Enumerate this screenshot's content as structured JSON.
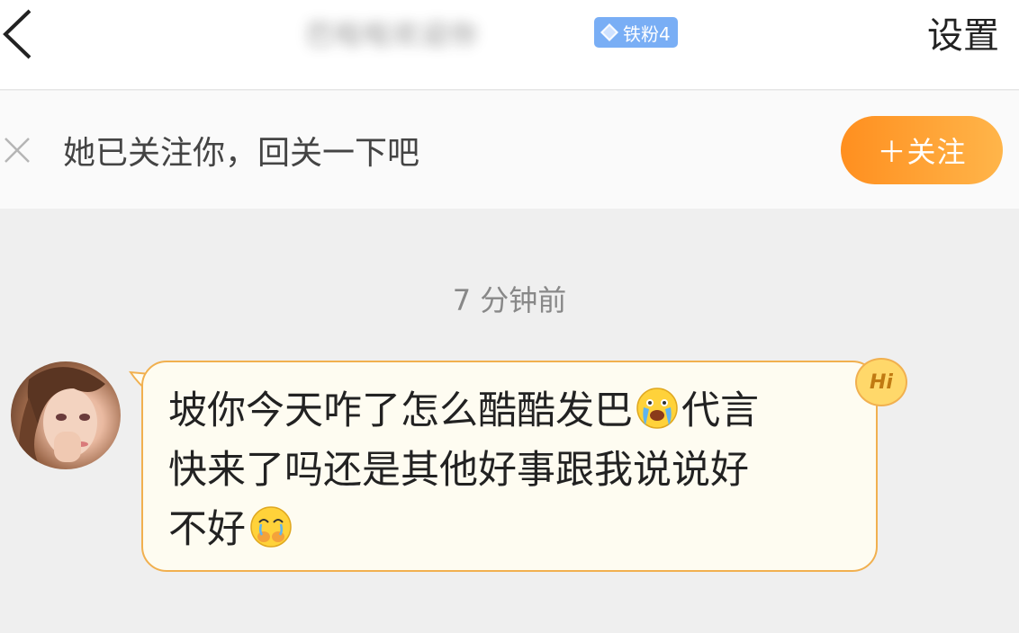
{
  "header": {
    "back_icon": "chevron-left-icon",
    "username": "巴啦啦欢迎你",
    "fan_badge": {
      "icon": "diamond-icon",
      "label": "铁粉4",
      "color": "#79aef5"
    },
    "settings_label": "设置"
  },
  "follow_banner": {
    "close_icon": "close-icon",
    "text": "她已关注你，回关一下吧",
    "button_label": "＋关注",
    "button_color": "#ff9a2a"
  },
  "chat": {
    "timestamp": "7 分钟前",
    "message": {
      "lines": [
        {
          "text": "坡你今天咋了怎么酷酷发巴",
          "emoji": "crying-face-icon",
          "tail": "代言"
        },
        {
          "text": "快来了吗还是其他好事跟我说说好"
        },
        {
          "text": "不好",
          "emoji": "pleading-face-icon"
        }
      ],
      "bubble_border": "#f1b04f",
      "bubble_bg": "#fefcf1"
    },
    "hi_badge": "Hi"
  }
}
